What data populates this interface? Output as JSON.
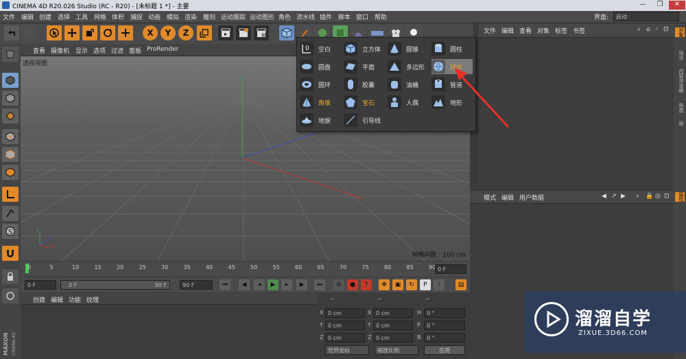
{
  "window": {
    "title": "CINEMA 4D R20.026 Studio (RC - R20) - [未标题 1 *] - 主要",
    "controls": [
      "—",
      "❐",
      "✕"
    ]
  },
  "menubar": {
    "items": [
      "文件",
      "编辑",
      "创建",
      "选择",
      "工具",
      "网格",
      "体积",
      "捕捉",
      "动画",
      "模拟",
      "渲染",
      "雕刻",
      "运动跟踪",
      "运动图形",
      "角色",
      "流水线",
      "插件",
      "脚本",
      "窗口",
      "帮助"
    ],
    "layout_label": "界面:",
    "layout_value": "启动"
  },
  "toolbar": {
    "axes": [
      "X",
      "Y",
      "Z"
    ]
  },
  "viewport": {
    "menu": [
      "查看",
      "摄像机",
      "显示",
      "选项",
      "过滤",
      "面板",
      "ProRender"
    ],
    "label": "透视视图",
    "grid_info": "网格间距 : 100 cm",
    "axis_labels": [
      "Y",
      "Z",
      "X"
    ]
  },
  "timeline": {
    "ticks": [
      "0",
      "5",
      "10",
      "15",
      "20",
      "25",
      "30",
      "35",
      "40",
      "45",
      "50",
      "55",
      "60",
      "65",
      "70",
      "75",
      "80",
      "85",
      "90"
    ],
    "current_frame": "0 F"
  },
  "transport": {
    "start": "0 F",
    "range_start": "0 F",
    "range_end": "90 F",
    "end": "90 F"
  },
  "material_panel": {
    "menu": [
      "创建",
      "编辑",
      "功能",
      "纹理"
    ]
  },
  "coord_panel": {
    "headers": [
      "--",
      "--",
      "--"
    ],
    "rows": [
      {
        "a": "X",
        "av": "0 cm",
        "b": "X",
        "bv": "0 cm",
        "c": "H",
        "cv": "0 °"
      },
      {
        "a": "Y",
        "av": "0 cm",
        "b": "Y",
        "bv": "0 cm",
        "c": "P",
        "cv": "0 °"
      },
      {
        "a": "Z",
        "av": "0 cm",
        "b": "Z",
        "bv": "0 cm",
        "c": "B",
        "cv": "0 °"
      }
    ],
    "world_select": "世界坐标",
    "scale_select": "缩放比例",
    "apply_button": "应用"
  },
  "object_panel": {
    "menu": [
      "文件",
      "编辑",
      "查看",
      "对象",
      "标签",
      "书签"
    ]
  },
  "attr_panel": {
    "menu": [
      "模式",
      "编辑",
      "用户数据"
    ]
  },
  "right_tabs": [
    "对象",
    "场次",
    "内容浏览器",
    "构造",
    "层",
    "属性"
  ],
  "popup": {
    "items": [
      {
        "label": "空白",
        "icon": "null-icon"
      },
      {
        "label": "立方体",
        "icon": "cube-icon"
      },
      {
        "label": "圆锥",
        "icon": "cone-icon"
      },
      {
        "label": "圆柱",
        "icon": "cylinder-icon"
      },
      {
        "label": "圆盘",
        "icon": "disc-icon"
      },
      {
        "label": "平面",
        "icon": "plane-icon"
      },
      {
        "label": "多边形",
        "icon": "polygon-icon"
      },
      {
        "label": "球体",
        "icon": "sphere-icon"
      },
      {
        "label": "圆环",
        "icon": "torus-icon"
      },
      {
        "label": "胶囊",
        "icon": "capsule-icon"
      },
      {
        "label": "油桶",
        "icon": "oil-tank-icon"
      },
      {
        "label": "管道",
        "icon": "tube-icon"
      },
      {
        "label": "角锥",
        "icon": "pyramid-icon"
      },
      {
        "label": "宝石",
        "icon": "platonic-icon"
      },
      {
        "label": "人偶",
        "icon": "figure-icon"
      },
      {
        "label": "地形",
        "icon": "landscape-icon"
      },
      {
        "label": "地貌",
        "icon": "relief-icon"
      },
      {
        "label": "引导线",
        "icon": "guide-icon"
      }
    ],
    "highlighted": "球体"
  },
  "watermark": {
    "cn": "溜溜自学",
    "en": "ZIXUE.3D66.COM"
  },
  "brand": {
    "maxon": "MAXON",
    "cinema": "CINEMA 4D"
  },
  "colors": {
    "accent_orange": "#e08a2b",
    "arrow_red": "#e8302a",
    "highlight_text": "#e0a030"
  }
}
